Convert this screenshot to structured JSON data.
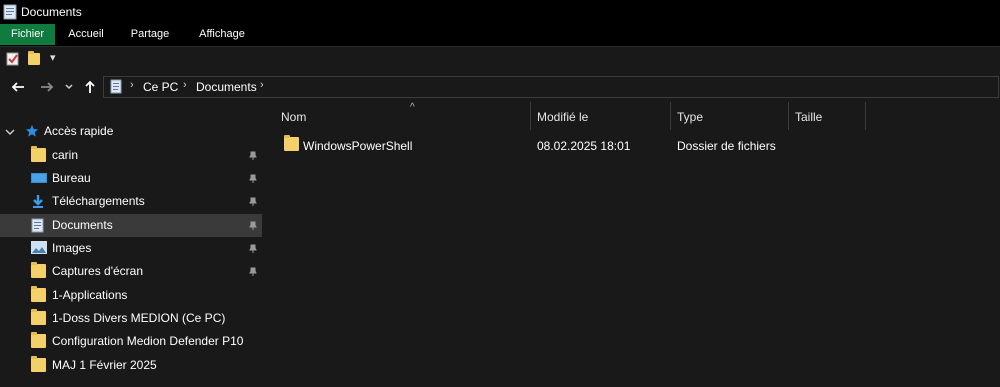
{
  "window": {
    "title": "Documents"
  },
  "ribbon": {
    "tabs": [
      "Fichier",
      "Accueil",
      "Partage",
      "Affichage"
    ]
  },
  "address": {
    "crumbs": [
      "Ce PC",
      "Documents"
    ]
  },
  "nav": {
    "quick_access": "Accès rapide",
    "items": [
      {
        "label": "carin",
        "icon": "folder-icon",
        "pinned": true
      },
      {
        "label": "Bureau",
        "icon": "desktop-icon",
        "pinned": true
      },
      {
        "label": "Téléchargements",
        "icon": "download-icon",
        "pinned": true
      },
      {
        "label": "Documents",
        "icon": "documents-icon",
        "pinned": true,
        "selected": true
      },
      {
        "label": "Images",
        "icon": "pictures-icon",
        "pinned": true
      },
      {
        "label": "Captures d'écran",
        "icon": "folder-icon",
        "pinned": true
      },
      {
        "label": "1-Applications",
        "icon": "folder-icon",
        "pinned": false
      },
      {
        "label": "1-Doss Divers MEDION (Ce PC)",
        "icon": "folder-icon",
        "pinned": false
      },
      {
        "label": "Configuration Medion Defender P10",
        "icon": "folder-icon",
        "pinned": false
      },
      {
        "label": "MAJ 1 Février 2025",
        "icon": "folder-icon",
        "pinned": false
      }
    ]
  },
  "content": {
    "columns": [
      "Nom",
      "Modifié le",
      "Type",
      "Taille"
    ],
    "rows": [
      {
        "name": "WindowsPowerShell",
        "modified": "08.02.2025 18:01",
        "type": "Dossier de fichiers",
        "size": ""
      }
    ]
  },
  "colors": {
    "background": "#191919",
    "file_tab": "#0f7b3e",
    "selection": "#3a3a3a",
    "folder": "#f3d06a"
  }
}
